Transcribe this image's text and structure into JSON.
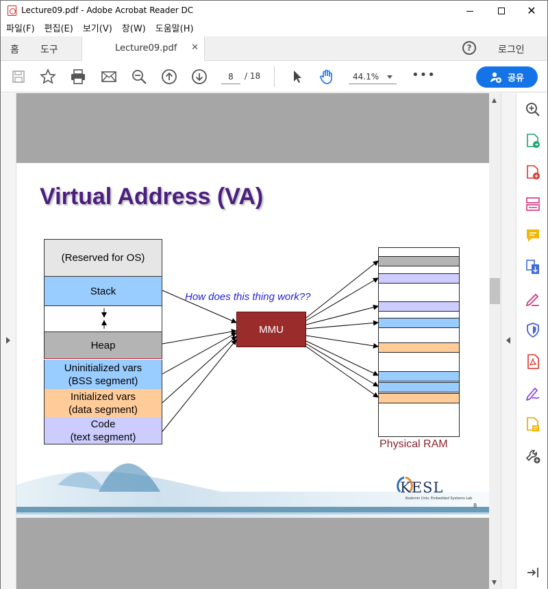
{
  "window": {
    "title": "Lecture09.pdf - Adobe Acrobat Reader DC"
  },
  "menu": [
    "파일(F)",
    "편집(E)",
    "보기(V)",
    "창(W)",
    "도움말(H)"
  ],
  "tabs": {
    "home": "홈",
    "tools": "도구",
    "document": "Lecture09.pdf",
    "login": "로그인"
  },
  "toolbar": {
    "page_current": "8",
    "page_total": "/  18",
    "zoom": "44.1%",
    "share_label": "공유"
  },
  "slide": {
    "title": "Virtual Address (VA)",
    "question": "How does this thing work??",
    "mmu_label": "MMU",
    "physical_ram_label": "Physical RAM",
    "logo": "KESL",
    "logo_sub": "Kookmin Univ. Embedded Systems Lab",
    "slide_number": "8",
    "segments": {
      "reserved": "(Reserved for OS)",
      "stack": "Stack",
      "heap": "Heap",
      "bss_line1": "Uninitialized vars",
      "bss_line2": "(BSS segment)",
      "data_line1": "Initialized vars",
      "data_line2": "(data segment)",
      "code_line1": "Code",
      "code_line2": "(text segment)"
    }
  },
  "colors": {
    "reserved": "#e6e6e6",
    "stack": "#99ccff",
    "heap": "#b4b4b4",
    "bss": "#99ccff",
    "data": "#ffcc99",
    "code": "#ccccff",
    "title": "#4b1f7e",
    "mmu": "#9a2c2c",
    "accent": "#1473e6"
  }
}
